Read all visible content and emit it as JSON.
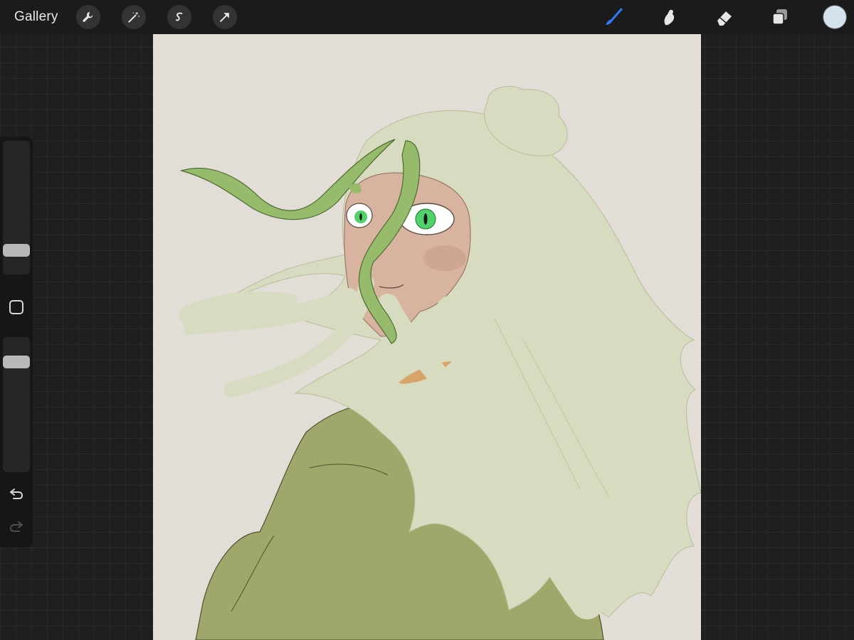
{
  "app": {
    "gallery_label": "Gallery"
  },
  "toolbar": {
    "left_tools": [
      "wrench-icon",
      "magic-wand-icon",
      "selection-icon",
      "transform-icon"
    ],
    "right_tools": [
      "brush-icon",
      "smudge-icon",
      "eraser-icon",
      "layers-icon"
    ],
    "active_tool": "brush-icon",
    "current_color": "#d4e2ee",
    "active_tool_color": "#2d7cf6"
  },
  "sidebar": {
    "brush_size_level": 0.15,
    "opacity_level": 0.85,
    "buttons": [
      "modify-button",
      "undo-button",
      "redo-button"
    ]
  },
  "canvas": {
    "background_color": "#e2ddd6",
    "hair_color": "#d7dbc0",
    "jacket_color": "#9fa86a",
    "strand_color": "#96bb6a",
    "skin_color": "#d8b4a0",
    "eye_color": "#4fd26a"
  }
}
